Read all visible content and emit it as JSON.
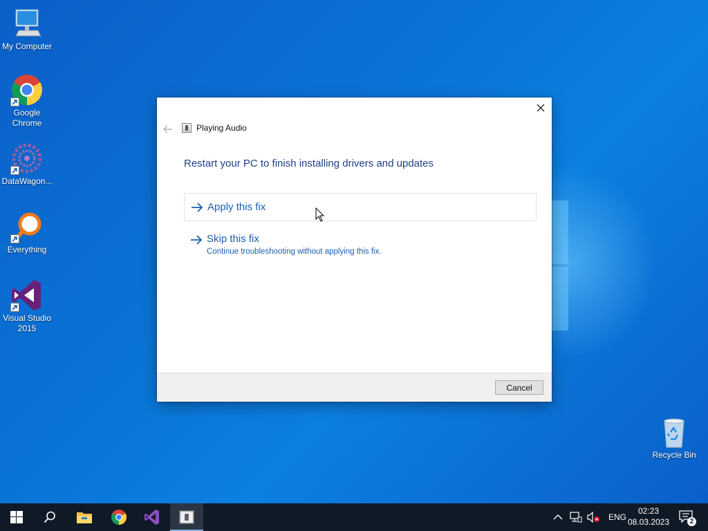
{
  "desktop": {
    "icons": [
      {
        "label": "My Computer"
      },
      {
        "label": "Google Chrome"
      },
      {
        "label": "DataWagon..."
      },
      {
        "label": "Everything"
      },
      {
        "label": "Visual Studio 2015"
      },
      {
        "label": "Recycle Bin"
      }
    ]
  },
  "dialog": {
    "title": "Playing Audio",
    "heading": "Restart your PC to finish installing drivers and updates",
    "options": [
      {
        "label": "Apply this fix",
        "description": ""
      },
      {
        "label": "Skip this fix",
        "description": "Continue troubleshooting without applying this fix."
      }
    ],
    "cancel_label": "Cancel"
  },
  "taskbar": {
    "pinned": [
      {
        "icon": "start-icon"
      },
      {
        "icon": "search-icon"
      },
      {
        "icon": "file-explorer-icon"
      },
      {
        "icon": "chrome-icon"
      },
      {
        "icon": "visual-studio-icon"
      },
      {
        "icon": "troubleshooter-icon",
        "active": true
      }
    ],
    "tray": {
      "language": "ENG",
      "time": "02:23",
      "date": "08.03.2023",
      "notification_count": "2"
    }
  },
  "colors": {
    "accent": "#1c5fb0",
    "heading": "#1c3f8a",
    "taskbar": "#101a26"
  }
}
